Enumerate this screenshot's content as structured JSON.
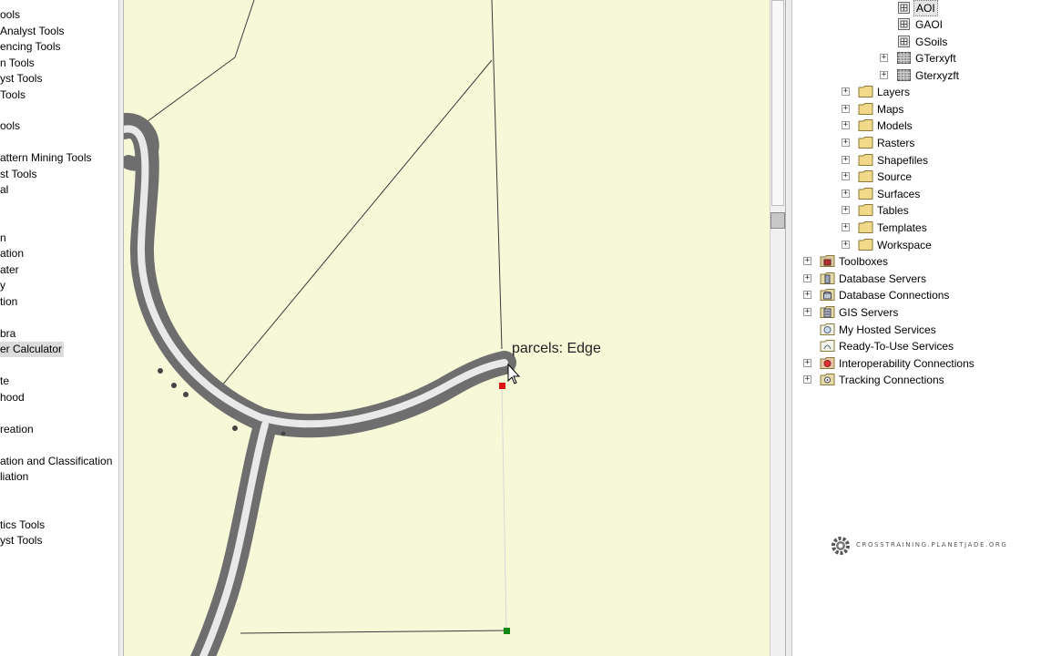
{
  "toolbox_list": [
    {
      "label": "ools"
    },
    {
      "label": " Analyst Tools"
    },
    {
      "label": "encing Tools"
    },
    {
      "label": "n Tools"
    },
    {
      "label": "yst Tools"
    },
    {
      "label": "Tools"
    },
    {
      "label": "ools"
    },
    {
      "label": "attern Mining Tools"
    },
    {
      "label": "st Tools"
    },
    {
      "label": "al"
    },
    {
      "label": "n"
    },
    {
      "label": "ation"
    },
    {
      "label": "ater"
    },
    {
      "label": "y"
    },
    {
      "label": "tion"
    },
    {
      "label": "bra"
    },
    {
      "label": "er Calculator",
      "selected": true
    },
    {
      "label": "te"
    },
    {
      "label": "hood"
    },
    {
      "label": "reation"
    },
    {
      "label": "ation and Classification"
    },
    {
      "label": "liation"
    },
    {
      "label": "tics Tools"
    },
    {
      "label": "yst Tools"
    }
  ],
  "map": {
    "snap_tip": "parcels: Edge",
    "background_color": "#f6f8d8",
    "road_color": "#6e6e6e",
    "vertex_colors": {
      "start": "#dd1111",
      "end": "#118811"
    }
  },
  "catalog_tree": [
    {
      "label": "AOI",
      "icon": "raster-dataset-icon",
      "expander": "",
      "selected": true
    },
    {
      "label": "GAOI",
      "icon": "raster-dataset-icon",
      "expander": ""
    },
    {
      "label": "GSoils",
      "icon": "raster-dataset-icon",
      "expander": ""
    },
    {
      "label": "GTerxyft",
      "icon": "grid-raster-icon",
      "expander": "+"
    },
    {
      "label": "Gterxyzft",
      "icon": "grid-raster-icon",
      "expander": "+"
    },
    {
      "label": "Layers",
      "icon": "folder-icon",
      "expander": "+"
    },
    {
      "label": "Maps",
      "icon": "folder-icon",
      "expander": "+"
    },
    {
      "label": "Models",
      "icon": "folder-icon",
      "expander": "+"
    },
    {
      "label": "Rasters",
      "icon": "folder-icon",
      "expander": "+"
    },
    {
      "label": "Shapefiles",
      "icon": "folder-icon",
      "expander": "+"
    },
    {
      "label": "Source",
      "icon": "folder-icon",
      "expander": "+"
    },
    {
      "label": "Surfaces",
      "icon": "folder-icon",
      "expander": "+"
    },
    {
      "label": "Tables",
      "icon": "folder-icon",
      "expander": "+"
    },
    {
      "label": "Templates",
      "icon": "folder-icon",
      "expander": "+"
    },
    {
      "label": "Workspace",
      "icon": "folder-icon",
      "expander": "+"
    },
    {
      "label": "Toolboxes",
      "icon": "toolbox-folder-icon",
      "expander": "+"
    },
    {
      "label": "Database Servers",
      "icon": "database-server-icon",
      "expander": "+"
    },
    {
      "label": "Database Connections",
      "icon": "database-connection-icon",
      "expander": "+"
    },
    {
      "label": "GIS Servers",
      "icon": "gis-server-icon",
      "expander": "+"
    },
    {
      "label": "My Hosted Services",
      "icon": "hosted-services-icon",
      "expander": ""
    },
    {
      "label": "Ready-To-Use Services",
      "icon": "ready-services-icon",
      "expander": ""
    },
    {
      "label": "Interoperability Connections",
      "icon": "interop-connection-icon",
      "expander": "+"
    },
    {
      "label": "Tracking Connections",
      "icon": "tracking-connection-icon",
      "expander": "+"
    }
  ],
  "watermark": {
    "text": "CROSSTRAINING.PLANETJADE.ORG",
    "icon": "gear-logo-icon"
  }
}
